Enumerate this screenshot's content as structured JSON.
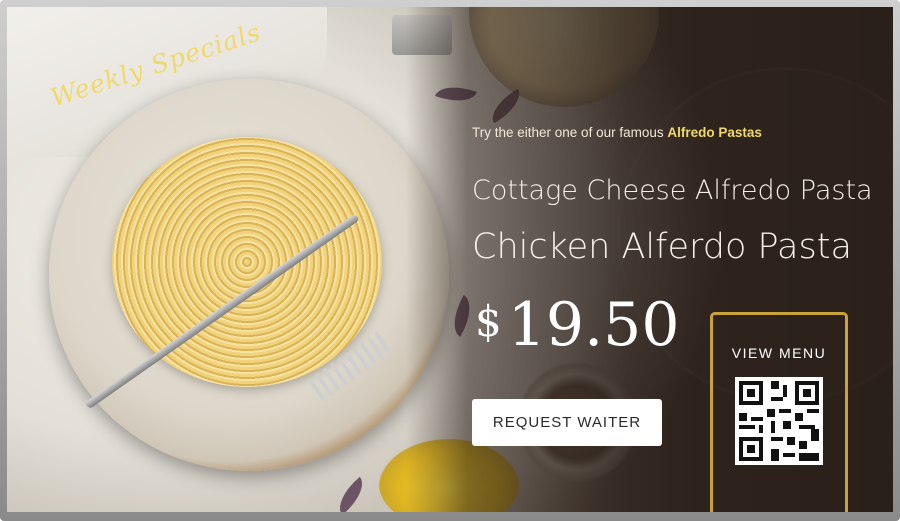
{
  "signage": {
    "script_title": "Weekly Specials",
    "tagline_prefix": "Try the either one of our famous ",
    "tagline_highlight": "Alfredo Pastas",
    "item1": "Cottage Cheese Alfredo Pasta",
    "item2": "Chicken Alferdo Pasta",
    "price_currency": "$",
    "price_value": "19.50",
    "request_button": "REQUEST WAITER",
    "menu_label": "VIEW MENU",
    "qr_icon": "qr-code-icon"
  },
  "colors": {
    "accent_gold": "#c9a23b",
    "script_yellow": "#f0d96a",
    "overlay_brown": "#3a2c24"
  }
}
